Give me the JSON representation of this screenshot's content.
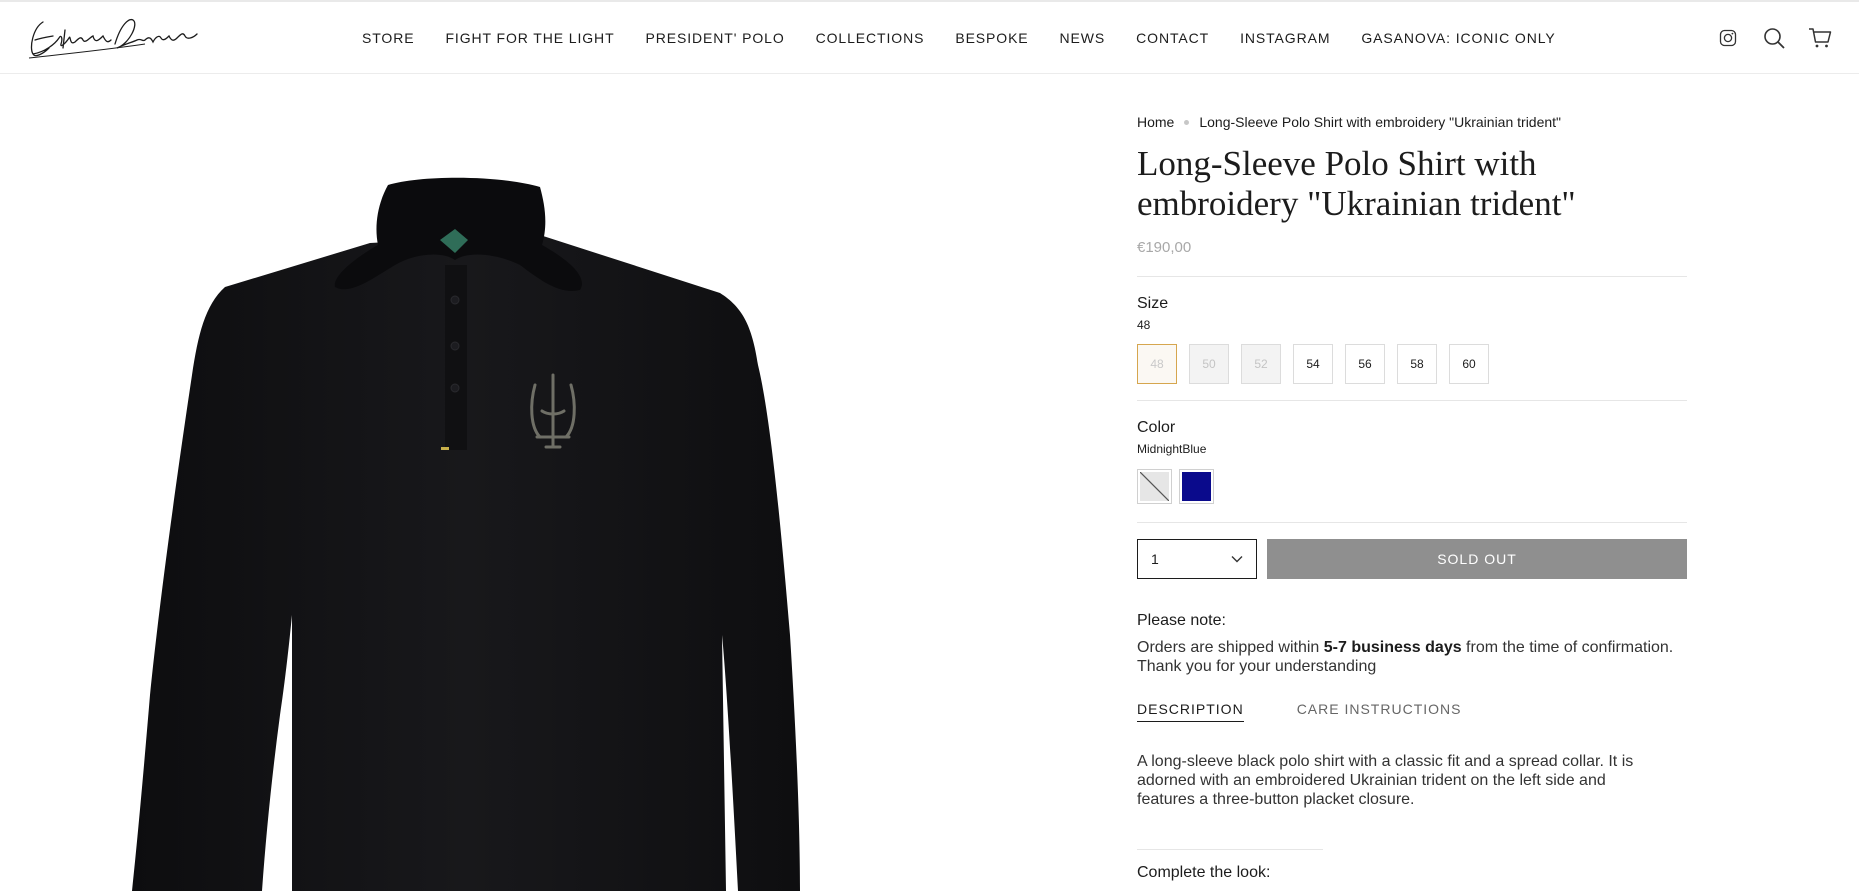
{
  "header": {
    "logo_text": "Ekaterina Dmitriev",
    "nav": [
      "STORE",
      "FIGHT FOR THE LIGHT",
      "PRESIDENT' POLO",
      "COLLECTIONS",
      "BESPOKE",
      "NEWS",
      "CONTACT",
      "INSTAGRAM",
      "GASANOVA: ICONIC ONLY"
    ],
    "icons": [
      "instagram-icon",
      "search-icon",
      "cart-icon"
    ]
  },
  "breadcrumb": {
    "home": "Home",
    "current": "Long-Sleeve Polo Shirt with embroidery \"Ukrainian trident\""
  },
  "product": {
    "title": "Long-Sleeve Polo Shirt with embroidery \"Ukrainian trident\"",
    "price": "€190,00",
    "image_alt": "Black long-sleeve polo shirt with embroidered trident",
    "size": {
      "label": "Size",
      "selected": "48",
      "options": [
        {
          "value": "48",
          "state": "selected-unavailable"
        },
        {
          "value": "50",
          "state": "unavailable"
        },
        {
          "value": "52",
          "state": "unavailable"
        },
        {
          "value": "54",
          "state": "available"
        },
        {
          "value": "56",
          "state": "available"
        },
        {
          "value": "58",
          "state": "available"
        },
        {
          "value": "60",
          "state": "available"
        }
      ]
    },
    "color": {
      "label": "Color",
      "selected": "MidnightBlue",
      "swatches": [
        {
          "name": "unavailable",
          "color": "#e6e6e6"
        },
        {
          "name": "MidnightBlue",
          "color": "#0a0a8c"
        }
      ]
    },
    "quantity": "1",
    "buy_button": "SOLD OUT"
  },
  "note": {
    "title": "Please note:",
    "text_before": "Orders are shipped within ",
    "text_bold": "5-7 business days",
    "text_after": " from the time of confirmation. Thank you for your understanding"
  },
  "tabs": [
    "DESCRIPTION",
    "CARE INSTRUCTIONS"
  ],
  "description": "A long-sleeve black polo shirt with a classic fit and a spread collar. It is adorned with an embroidered Ukrainian trident on the left side and features a three-button placket closure.",
  "complete_look": "Complete the look:",
  "colors": {
    "text": "#1c1c1c",
    "sold_out_bg": "#8f8f8f",
    "selected_border": "#d6a64e",
    "shirt": "#141416"
  }
}
